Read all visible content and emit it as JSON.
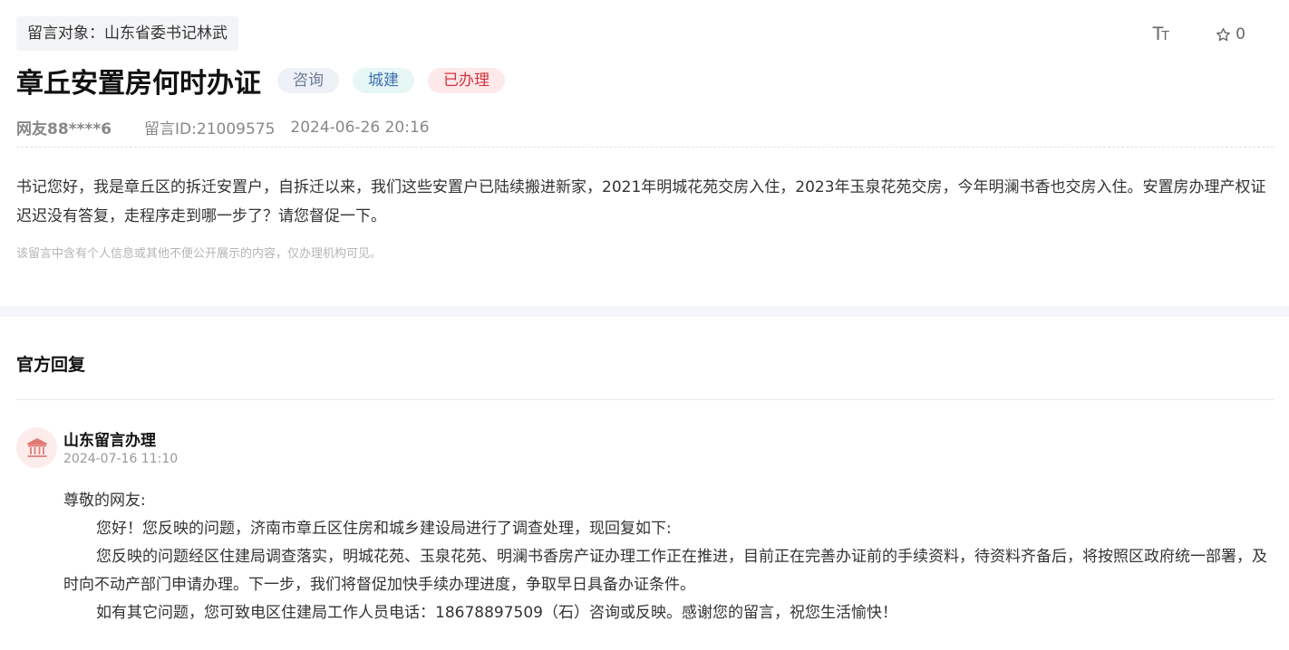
{
  "message": {
    "target_label": "留言对象：山东省委书记林武",
    "title": "章丘安置房何时办证",
    "tags": {
      "consult": "咨询",
      "category": "城建",
      "status": "已办理"
    },
    "tag_colors": {
      "consult_bg": "#eef1f7",
      "category_bg": "#e6f7f5",
      "status_bg": "#fde8ea",
      "status_text": "#d2353f"
    },
    "user": "网友88****6",
    "message_id": "留言ID:21009575",
    "datetime": "2024-06-26 20:16",
    "content": "书记您好，我是章丘区的拆迁安置户，自拆迁以来，我们这些安置户已陆续搬进新家，2021年明城花苑交房入住，2023年玉泉花苑交房，今年明澜书香也交房入住。安置房办理产权证迟迟没有答复，走程序走到哪一步了？请您督促一下。",
    "privacy_note": "该留言中含有个人信息或其他不便公开展示的内容，仅办理机构可见。"
  },
  "toolbar": {
    "font_size_icon": "text-size-icon",
    "font_size_glyph_big": "T",
    "font_size_glyph_small": "T",
    "favorite_icon": "star-outline-icon",
    "favorite_count": "0"
  },
  "reply": {
    "heading": "官方回复",
    "org_icon": "government-building-icon",
    "org_name": "山东留言办理",
    "datetime": "2024-07-16 11:10",
    "salutation": "尊敬的网友:",
    "paragraphs": [
      "您好！您反映的问题，济南市章丘区住房和城乡建设局进行了调查处理，现回复如下:",
      "您反映的问题经区住建局调查落实，明城花苑、玉泉花苑、明澜书香房产证办理工作正在推进，目前正在完善办证前的手续资料，待资料齐备后，将按照区政府统一部署，及时向不动产部门申请办理。下一步，我们将督促加快手续办理进度，争取早日具备办证条件。",
      "如有其它问题，您可致电区住建局工作人员电话：18678897509（石）咨询或反映。感谢您的留言，祝您生活愉快！"
    ]
  }
}
